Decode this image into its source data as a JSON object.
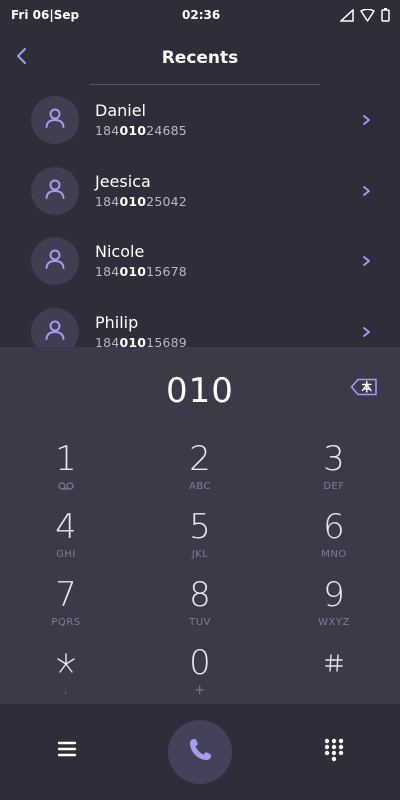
{
  "status_bar": {
    "date": "Fri 06|Sep",
    "time": "02:36",
    "icons": [
      "signal-icon",
      "wifi-icon",
      "battery-icon"
    ]
  },
  "header": {
    "title": "Recents",
    "back_icon": "chevron-left-icon"
  },
  "recents": [
    {
      "name": "Daniel",
      "number_prefix": "184",
      "number_match": "010",
      "number_suffix": "24685"
    },
    {
      "name": "Jeesica",
      "number_prefix": "184",
      "number_match": "010",
      "number_suffix": "25042"
    },
    {
      "name": "Nicole",
      "number_prefix": "184",
      "number_match": "010",
      "number_suffix": "15678"
    },
    {
      "name": "Philip",
      "number_prefix": "184",
      "number_match": "010",
      "number_suffix": "15689"
    }
  ],
  "dialer": {
    "input_value": "010",
    "delete_icon": "backspace-icon"
  },
  "keypad": {
    "keys": [
      {
        "digit": "1",
        "letters": "voicemail"
      },
      {
        "digit": "2",
        "letters": "ABC"
      },
      {
        "digit": "3",
        "letters": "DEF"
      },
      {
        "digit": "4",
        "letters": "GHI"
      },
      {
        "digit": "5",
        "letters": "JKL"
      },
      {
        "digit": "6",
        "letters": "MNO"
      },
      {
        "digit": "7",
        "letters": "PQRS"
      },
      {
        "digit": "8",
        "letters": "TUV"
      },
      {
        "digit": "9",
        "letters": "WXYZ"
      },
      {
        "digit": "*",
        "letters": ","
      },
      {
        "digit": "0",
        "letters": "+"
      },
      {
        "digit": "#",
        "letters": ""
      }
    ]
  },
  "bottom_bar": {
    "menu_icon": "menu-icon",
    "call_icon": "phone-icon",
    "keypad_icon": "dialpad-icon"
  },
  "colors": {
    "background": "#2e2d3a",
    "panel": "#3b3a49",
    "accent": "#a39cf0",
    "avatar_bg": "#403e50"
  }
}
